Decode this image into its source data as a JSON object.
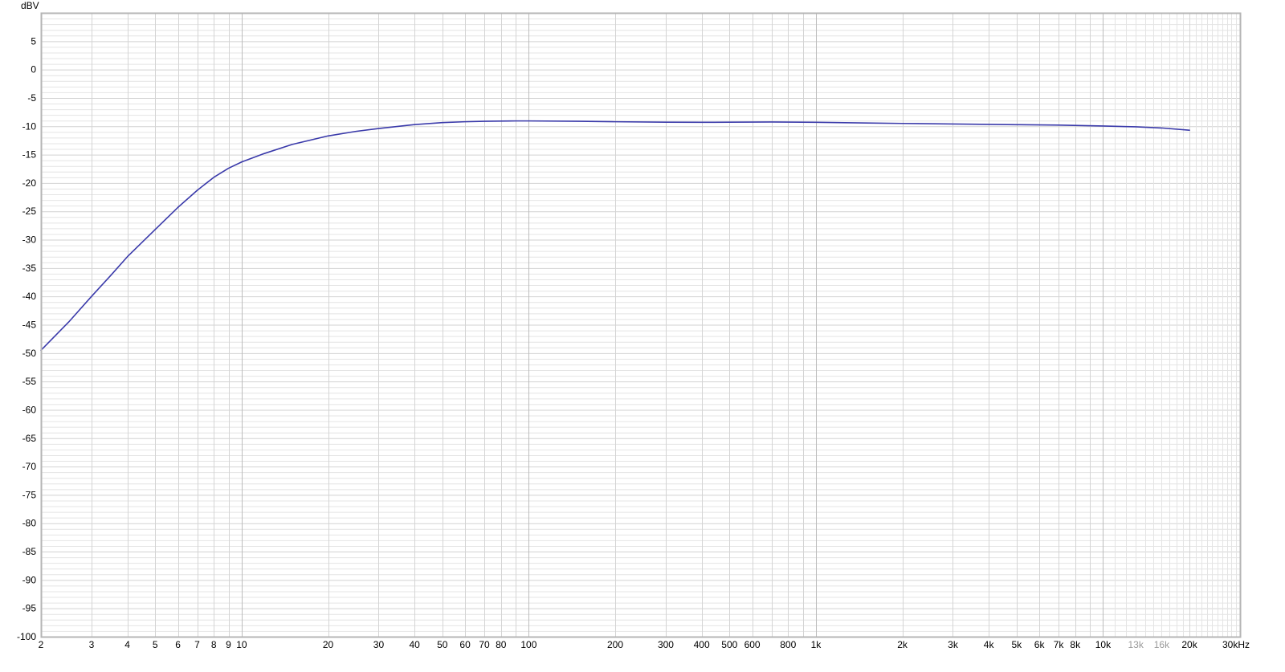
{
  "chart_data": {
    "type": "line",
    "title": "",
    "xlabel": "",
    "ylabel": "dBV",
    "x_scale": "log",
    "xlim": [
      2,
      30000
    ],
    "ylim": [
      -100,
      10
    ],
    "grid": true,
    "legend": "none",
    "colors": {
      "line": "#3a3aaa",
      "grid_minor": "#e4e4e4",
      "grid_major": "#bcbcbc",
      "frame": "#b5b5b5",
      "tick_text": "#000000",
      "tick_text_dim": "#9a9a9a"
    },
    "x_ticks": [
      {
        "v": 2,
        "label": "2"
      },
      {
        "v": 3,
        "label": "3"
      },
      {
        "v": 4,
        "label": "4"
      },
      {
        "v": 5,
        "label": "5"
      },
      {
        "v": 6,
        "label": "6"
      },
      {
        "v": 7,
        "label": "7"
      },
      {
        "v": 8,
        "label": "8"
      },
      {
        "v": 9,
        "label": "9"
      },
      {
        "v": 10,
        "label": "10"
      },
      {
        "v": 20,
        "label": "20"
      },
      {
        "v": 30,
        "label": "30"
      },
      {
        "v": 40,
        "label": "40"
      },
      {
        "v": 50,
        "label": "50"
      },
      {
        "v": 60,
        "label": "60"
      },
      {
        "v": 70,
        "label": "70"
      },
      {
        "v": 80,
        "label": "80"
      },
      {
        "v": 100,
        "label": "100"
      },
      {
        "v": 200,
        "label": "200"
      },
      {
        "v": 300,
        "label": "300"
      },
      {
        "v": 400,
        "label": "400"
      },
      {
        "v": 500,
        "label": "500"
      },
      {
        "v": 600,
        "label": "600"
      },
      {
        "v": 800,
        "label": "800"
      },
      {
        "v": 1000,
        "label": "1k"
      },
      {
        "v": 2000,
        "label": "2k"
      },
      {
        "v": 3000,
        "label": "3k"
      },
      {
        "v": 4000,
        "label": "4k"
      },
      {
        "v": 5000,
        "label": "5k"
      },
      {
        "v": 6000,
        "label": "6k"
      },
      {
        "v": 7000,
        "label": "7k"
      },
      {
        "v": 8000,
        "label": "8k"
      },
      {
        "v": 10000,
        "label": "10k"
      },
      {
        "v": 13000,
        "label": "13k",
        "dim": true
      },
      {
        "v": 16000,
        "label": "16k",
        "dim": true
      },
      {
        "v": 20000,
        "label": "20k"
      },
      {
        "v": 30000,
        "label": "30kHz"
      }
    ],
    "y_ticks": [
      5,
      0,
      -5,
      -10,
      -15,
      -20,
      -25,
      -30,
      -35,
      -40,
      -45,
      -50,
      -55,
      -60,
      -65,
      -70,
      -75,
      -80,
      -85,
      -90,
      -95,
      -100
    ],
    "series": [
      {
        "x": [
          2,
          2.5,
          3,
          3.5,
          4,
          5,
          6,
          7,
          8,
          9,
          10,
          12,
          15,
          20,
          25,
          30,
          40,
          50,
          60,
          70,
          80,
          90,
          100,
          150,
          200,
          300,
          400,
          500,
          700,
          1000,
          1500,
          2000,
          3000,
          5000,
          7000,
          10000,
          13000,
          16000,
          20000
        ],
        "y": [
          -49.5,
          -44.5,
          -40.0,
          -36.3,
          -33.0,
          -28.2,
          -24.3,
          -21.3,
          -19.0,
          -17.4,
          -16.3,
          -14.8,
          -13.2,
          -11.7,
          -10.9,
          -10.4,
          -9.7,
          -9.35,
          -9.2,
          -9.12,
          -9.08,
          -9.06,
          -9.06,
          -9.12,
          -9.2,
          -9.28,
          -9.3,
          -9.28,
          -9.25,
          -9.3,
          -9.42,
          -9.5,
          -9.6,
          -9.72,
          -9.8,
          -9.95,
          -10.1,
          -10.3,
          -10.7
        ]
      }
    ]
  }
}
